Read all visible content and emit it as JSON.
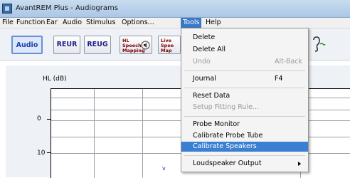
{
  "window": {
    "title": "AvantREM Plus - Audiograms"
  },
  "menubar": [
    "File",
    "Function",
    "Ear",
    "Audio",
    "Stimulus",
    "Options...",
    "Tools",
    "Help"
  ],
  "toolbar": {
    "audio": "Audio",
    "reur": "REUR",
    "reug": "REUG",
    "hl_speech_mapping": [
      "HL",
      "Speech",
      "Mapping"
    ],
    "live_speech_mapping": [
      "Live",
      "Spee",
      "Map"
    ]
  },
  "chart": {
    "ylabel": "HL (dB)",
    "yticks": [
      "0",
      "10"
    ],
    "marker": "v"
  },
  "tools_menu": {
    "items": [
      {
        "label": "Delete",
        "shortcut": "",
        "enabled": true
      },
      {
        "label": "Delete All",
        "shortcut": "",
        "enabled": true
      },
      {
        "label": "Undo",
        "shortcut": "Alt-Back",
        "enabled": false
      },
      {
        "label": "Journal",
        "shortcut": "F4",
        "enabled": true
      },
      {
        "label": "Reset Data",
        "shortcut": "",
        "enabled": true
      },
      {
        "label": "Setup Fitting Rule...",
        "shortcut": "",
        "enabled": false
      },
      {
        "label": "Probe Monitor",
        "shortcut": "",
        "enabled": true
      },
      {
        "label": "Calibrate Probe Tube",
        "shortcut": "",
        "enabled": true
      },
      {
        "label": "Calibrate Speakers",
        "shortcut": "",
        "enabled": true,
        "highlighted": true
      },
      {
        "label": "Loudspeaker Output",
        "shortcut": "",
        "enabled": true,
        "submenu": true
      }
    ]
  }
}
